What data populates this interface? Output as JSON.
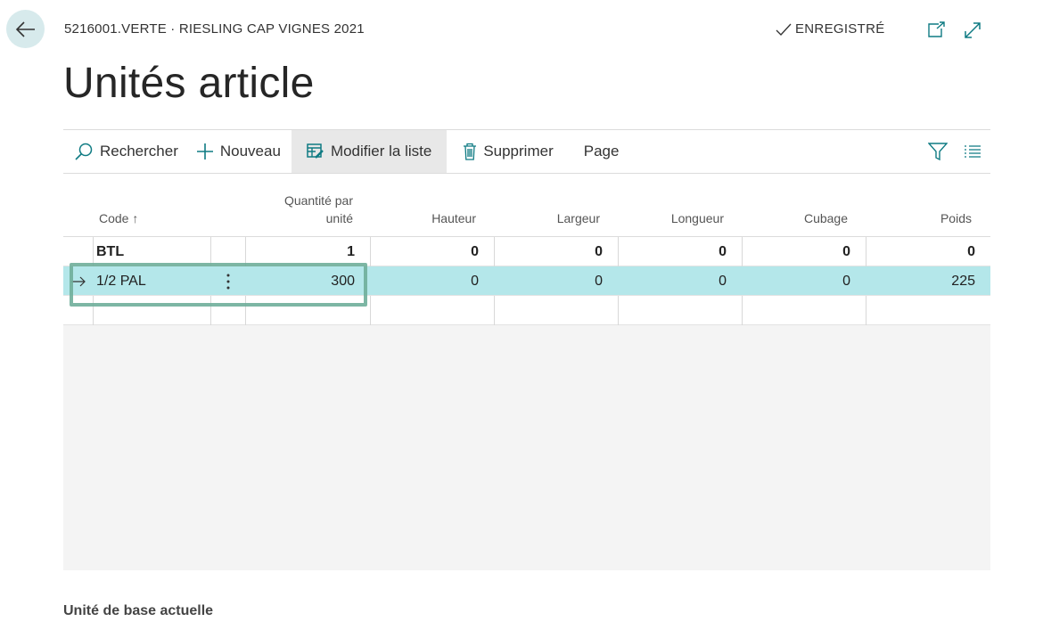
{
  "header": {
    "breadcrumb": "5216001.VERTE · RIESLING CAP VIGNES 2021",
    "saved_status": "ENREGISTRÉ",
    "page_title": "Unités article"
  },
  "toolbar": {
    "search_label": "Rechercher",
    "new_label": "Nouveau",
    "edit_list_label": "Modifier la liste",
    "delete_label": "Supprimer",
    "page_label": "Page"
  },
  "columns": {
    "code": "Code ↑",
    "qty_line1": "Quantité par",
    "qty_line2": "unité",
    "height": "Hauteur",
    "width": "Largeur",
    "length": "Longueur",
    "cubage": "Cubage",
    "weight": "Poids"
  },
  "rows": [
    {
      "code": "BTL",
      "qty": "1",
      "height": "0",
      "width": "0",
      "length": "0",
      "cubage": "0",
      "weight": "0"
    },
    {
      "code": "1/2 PAL",
      "qty": "300",
      "height": "0",
      "width": "0",
      "length": "0",
      "cubage": "0",
      "weight": "225"
    }
  ],
  "footer": {
    "label": "Unité de base actuelle"
  },
  "colors": {
    "accent": "#0f7b83",
    "selected_row": "#b4e7ea",
    "highlight": "#6fae9a"
  }
}
